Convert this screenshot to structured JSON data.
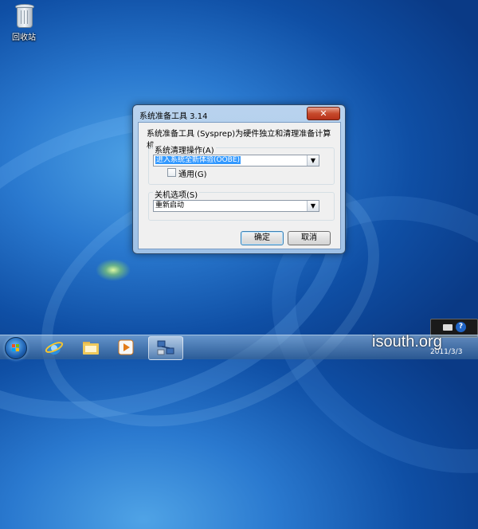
{
  "desktop": {
    "recycle_bin_label": "回收站"
  },
  "dialog": {
    "title": "系统准备工具 3.14",
    "close_label": "✕",
    "description": "系统准备工具 (Sysprep)为硬件独立和清理准备计算机。",
    "cleanup": {
      "group_label": "系统清理操作(A)",
      "selected": "进入系统全新体验(OOBE)",
      "generalize_label": "通用(G)",
      "generalize_checked": false
    },
    "shutdown": {
      "group_label": "关机选项(S)",
      "selected": "重新启动"
    },
    "ok_label": "确定",
    "cancel_label": "取消"
  },
  "taskbar": {
    "date": "2011/3/3"
  },
  "watermark": "isouth.org",
  "colors": {
    "close_button": "#c74a2c",
    "selection": "#3399ff",
    "desktop_blue": "#2a79cf"
  },
  "icons": [
    "recycle-bin-icon",
    "start-orb-icon",
    "ie-icon",
    "folder-icon",
    "media-player-icon",
    "network-app-icon",
    "keyboard-icon",
    "help-icon"
  ]
}
